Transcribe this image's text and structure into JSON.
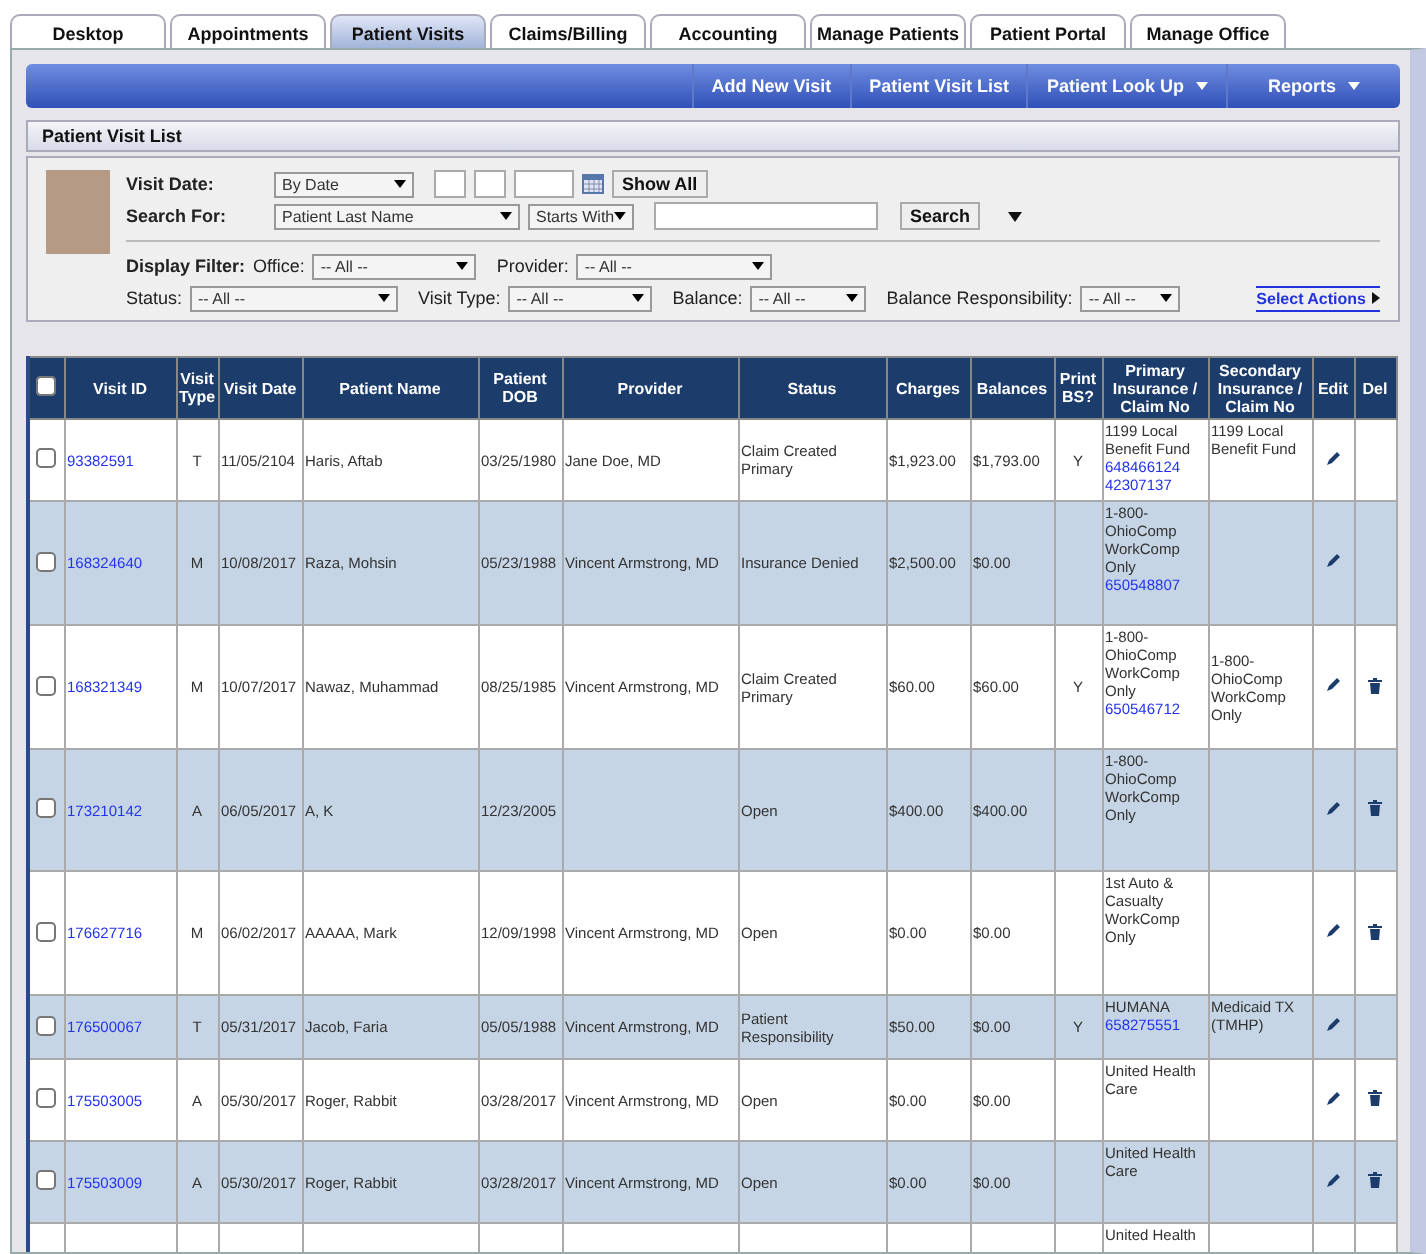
{
  "tabs": [
    {
      "label": "Desktop",
      "selected": false
    },
    {
      "label": "Appointments",
      "selected": false
    },
    {
      "label": "Patient Visits",
      "selected": true
    },
    {
      "label": "Claims/Billing",
      "selected": false
    },
    {
      "label": "Accounting",
      "selected": false
    },
    {
      "label": "Manage Patients",
      "selected": false
    },
    {
      "label": "Patient Portal",
      "selected": false
    },
    {
      "label": "Manage Office",
      "selected": false
    }
  ],
  "nav": [
    {
      "label": "Add New Visit",
      "has_menu": false
    },
    {
      "label": "Patient Visit List",
      "has_menu": false
    },
    {
      "label": "Patient Look Up",
      "has_menu": true
    },
    {
      "label": "Reports",
      "has_menu": true
    }
  ],
  "section_title": "Patient Visit List",
  "filters": {
    "visit_date_label": "Visit Date:",
    "visit_date_mode": "By Date",
    "show_all": "Show All",
    "search_for_label": "Search For:",
    "search_field": "Patient Last Name",
    "search_match": "Starts With",
    "search_button": "Search",
    "display_filter_label": "Display Filter:",
    "dropdowns_row1": [
      {
        "label": "Office:",
        "value": "-- All --"
      },
      {
        "label": "Provider:",
        "value": "-- All --"
      }
    ],
    "dropdowns_row2": [
      {
        "label": "Status:",
        "value": "-- All --"
      },
      {
        "label": "Visit Type:",
        "value": "-- All --"
      },
      {
        "label": "Balance:",
        "value": "-- All --"
      },
      {
        "label": "Balance Responsibility:",
        "value": "-- All --"
      }
    ],
    "select_actions": "Select Actions"
  },
  "table": {
    "all_checked": false,
    "columns": [
      "Visit ID",
      "Visit Type",
      "Visit Date",
      "Patient Name",
      "Patient DOB",
      "Provider",
      "Status",
      "Charges",
      "Balances",
      "Print BS?",
      "Primary Insurance / Claim No",
      "Secondary Insurance / Claim No",
      "Edit",
      "Del"
    ],
    "rows": [
      {
        "checked": false,
        "visit_id": "93382591",
        "visit_type": "T",
        "visit_date": "11/05/2104",
        "patient_name": "Haris, Aftab",
        "patient_dob": "03/25/1980",
        "provider": "Jane Doe, MD",
        "status": "Claim Created Primary",
        "charges": "$1,923.00",
        "balances": "$1,793.00",
        "print_bs": "Y",
        "primary_insurance": "1199 Local Benefit Fund",
        "claim_numbers": [
          "648466124",
          "42307137"
        ],
        "secondary_insurance": "1199 Local Benefit Fund",
        "edit": true,
        "delete": false
      },
      {
        "checked": false,
        "visit_id": "168324640",
        "visit_type": "M",
        "visit_date": "10/08/2017",
        "patient_name": "Raza, Mohsin",
        "patient_dob": "05/23/1988",
        "provider": "Vincent Armstrong, MD",
        "status": "Insurance Denied",
        "charges": "$2,500.00",
        "balances": "$0.00",
        "print_bs": "",
        "primary_insurance": "1-800-OhioComp WorkComp Only",
        "claim_numbers": [
          "650548807"
        ],
        "secondary_insurance": "",
        "edit": true,
        "delete": false
      },
      {
        "checked": false,
        "visit_id": "168321349",
        "visit_type": "M",
        "visit_date": "10/07/2017",
        "patient_name": "Nawaz, Muhammad",
        "patient_dob": "08/25/1985",
        "provider": "Vincent Armstrong, MD",
        "status": "Claim Created Primary",
        "charges": "$60.00",
        "balances": "$60.00",
        "print_bs": "Y",
        "primary_insurance": "1-800-OhioComp WorkComp Only",
        "claim_numbers": [
          "650546712"
        ],
        "secondary_insurance": "1-800-OhioComp WorkComp Only",
        "edit": true,
        "delete": true
      },
      {
        "checked": false,
        "visit_id": "173210142",
        "visit_type": "A",
        "visit_date": "06/05/2017",
        "patient_name": "A, K",
        "patient_dob": "12/23/2005",
        "provider": "",
        "status": "Open",
        "charges": "$400.00",
        "balances": "$400.00",
        "print_bs": "",
        "primary_insurance": "1-800-OhioComp WorkComp Only",
        "claim_numbers": [],
        "secondary_insurance": "",
        "edit": true,
        "delete": true
      },
      {
        "checked": false,
        "visit_id": "176627716",
        "visit_type": "M",
        "visit_date": "06/02/2017",
        "patient_name": "AAAAA, Mark",
        "patient_dob": "12/09/1998",
        "provider": "Vincent Armstrong, MD",
        "status": "Open",
        "charges": "$0.00",
        "balances": "$0.00",
        "print_bs": "",
        "primary_insurance": "1st Auto & Casualty WorkComp Only",
        "claim_numbers": [],
        "secondary_insurance": "",
        "edit": true,
        "delete": true
      },
      {
        "checked": false,
        "visit_id": "176500067",
        "visit_type": "T",
        "visit_date": "05/31/2017",
        "patient_name": "Jacob, Faria",
        "patient_dob": "05/05/1988",
        "provider": "Vincent Armstrong, MD",
        "status": "Patient Responsibility",
        "charges": "$50.00",
        "balances": "$0.00",
        "print_bs": "Y",
        "primary_insurance": "HUMANA",
        "claim_numbers": [
          "658275551"
        ],
        "secondary_insurance": "Medicaid TX (TMHP)",
        "edit": true,
        "delete": false
      },
      {
        "checked": false,
        "visit_id": "175503005",
        "visit_type": "A",
        "visit_date": "05/30/2017",
        "patient_name": "Roger, Rabbit",
        "patient_dob": "03/28/2017",
        "provider": "Vincent Armstrong, MD",
        "status": "Open",
        "charges": "$0.00",
        "balances": "$0.00",
        "print_bs": "",
        "primary_insurance": "United Health Care",
        "claim_numbers": [],
        "secondary_insurance": "",
        "edit": true,
        "delete": true
      },
      {
        "checked": false,
        "visit_id": "175503009",
        "visit_type": "A",
        "visit_date": "05/30/2017",
        "patient_name": "Roger, Rabbit",
        "patient_dob": "03/28/2017",
        "provider": "Vincent Armstrong, MD",
        "status": "Open",
        "charges": "$0.00",
        "balances": "$0.00",
        "print_bs": "",
        "primary_insurance": "United Health Care",
        "claim_numbers": [],
        "secondary_insurance": "",
        "edit": true,
        "delete": true
      },
      {
        "visit_id": "",
        "visit_type": "",
        "visit_date": "",
        "patient_name": "",
        "patient_dob": "",
        "provider": "",
        "status": "",
        "charges": "",
        "balances": "",
        "print_bs": "",
        "primary_insurance": "United Health",
        "claim_numbers": [],
        "secondary_insurance": ""
      }
    ]
  }
}
